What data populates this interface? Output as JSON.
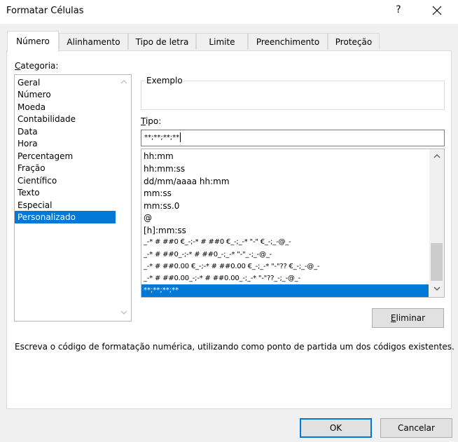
{
  "window": {
    "title": "Formatar Células",
    "help": "?"
  },
  "tabs": [
    {
      "label": "Número",
      "active": true
    },
    {
      "label": "Alinhamento"
    },
    {
      "label": "Tipo de letra"
    },
    {
      "label": "Limite"
    },
    {
      "label": "Preenchimento"
    },
    {
      "label": "Proteção"
    }
  ],
  "category": {
    "label_prefix": "C",
    "label_rest": "ategoria:",
    "items": [
      "Geral",
      "Número",
      "Moeda",
      "Contabilidade",
      "Data",
      "Hora",
      "Percentagem",
      "Fração",
      "Científico",
      "Texto",
      "Especial",
      "Personalizado"
    ],
    "selected": "Personalizado"
  },
  "example": {
    "legend": "Exemplo"
  },
  "type": {
    "label_prefix": "T",
    "label_rest": "ipo:",
    "value": "**;**;**;**"
  },
  "formats": [
    "hh:mm",
    "hh:mm:ss",
    "dd/mm/aaaa hh:mm",
    "mm:ss",
    "mm:ss.0",
    "@",
    "[h]:mm:ss",
    "_-* # ##0 €_-;-* # ##0 €_-;_-* \"-\" €_-;_-@_-",
    "_-* # ##0_-;-* # ##0_-;_-* \"-\"_-;_-@_-",
    "_-* # ##0.00 €_-;-* # ##0.00 €_-;_-* \"-\"?? €_-;_-@_-",
    "_-* # ##0.00_-;-* # ##0.00_-;_-* \"-\"??_-;_-@_-",
    "**;**;**;**"
  ],
  "buttons": {
    "delete_prefix": "E",
    "delete_rest": "liminar",
    "ok": "OK",
    "cancel": "Cancelar"
  },
  "description": "Escreva o código de formatação numérica, utilizando como ponto de partida um dos códigos existentes."
}
